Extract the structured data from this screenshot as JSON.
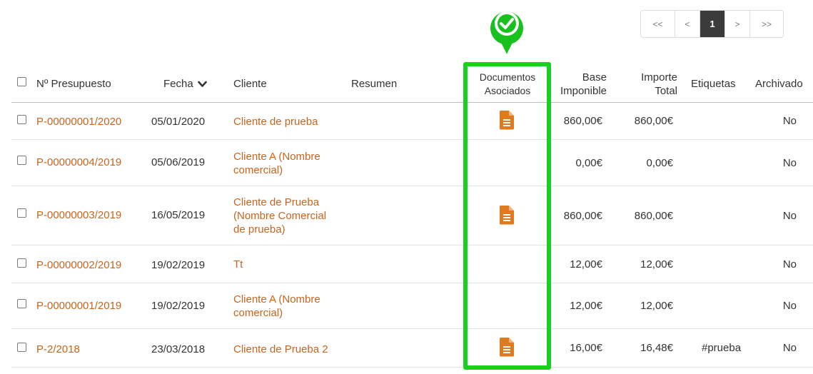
{
  "pagination": {
    "first": "<<",
    "prev": "<",
    "current": "1",
    "next": ">",
    "last": ">>"
  },
  "headers": {
    "number": "Nº Presupuesto",
    "date": "Fecha",
    "client": "Cliente",
    "summary": "Resumen",
    "documents_line1": "Documentos",
    "documents_line2": "Asociados",
    "base_line1": "Base",
    "base_line2": "Imponible",
    "total_line1": "Importe",
    "total_line2": "Total",
    "tags": "Etiquetas",
    "archived": "Archivado"
  },
  "rows": [
    {
      "number": "P-00000001/2020",
      "date": "05/01/2020",
      "client_line1": "Cliente de prueba",
      "client_line2": "",
      "client_line3": "",
      "has_document": true,
      "base": "860,00€",
      "total": "860,00€",
      "tags": "",
      "archived": "No"
    },
    {
      "number": "P-00000004/2019",
      "date": "05/06/2019",
      "client_line1": "Cliente A (Nombre",
      "client_line2": "comercial)",
      "client_line3": "",
      "has_document": false,
      "base": "0,00€",
      "total": "0,00€",
      "tags": "",
      "archived": "No"
    },
    {
      "number": "P-00000003/2019",
      "date": "16/05/2019",
      "client_line1": "Cliente de Prueba",
      "client_line2": "(Nombre Comercial",
      "client_line3": "de prueba)",
      "has_document": true,
      "base": "860,00€",
      "total": "860,00€",
      "tags": "",
      "archived": "No"
    },
    {
      "number": "P-00000002/2019",
      "date": "19/02/2019",
      "client_line1": "Tt",
      "client_line2": "",
      "client_line3": "",
      "has_document": false,
      "base": "12,00€",
      "total": "12,00€",
      "tags": "",
      "archived": "No"
    },
    {
      "number": "P-00000001/2019",
      "date": "19/02/2019",
      "client_line1": "Cliente A (Nombre",
      "client_line2": "comercial)",
      "client_line3": "",
      "has_document": false,
      "base": "12,00€",
      "total": "12,00€",
      "tags": "",
      "archived": "No"
    },
    {
      "number": "P-2/2018",
      "date": "23/03/2018",
      "client_line1": "Cliente de Prueba 2",
      "client_line2": "",
      "client_line3": "",
      "has_document": true,
      "base": "16,00€",
      "total": "16,48€",
      "tags": "#prueba",
      "archived": "No"
    }
  ],
  "colors": {
    "link": "#c8641e",
    "highlight": "#18d11e",
    "document_icon": "#e07a1f"
  },
  "icons": {
    "document": "document-icon",
    "sort": "chevron-down-icon",
    "marker": "check-marker-icon"
  }
}
